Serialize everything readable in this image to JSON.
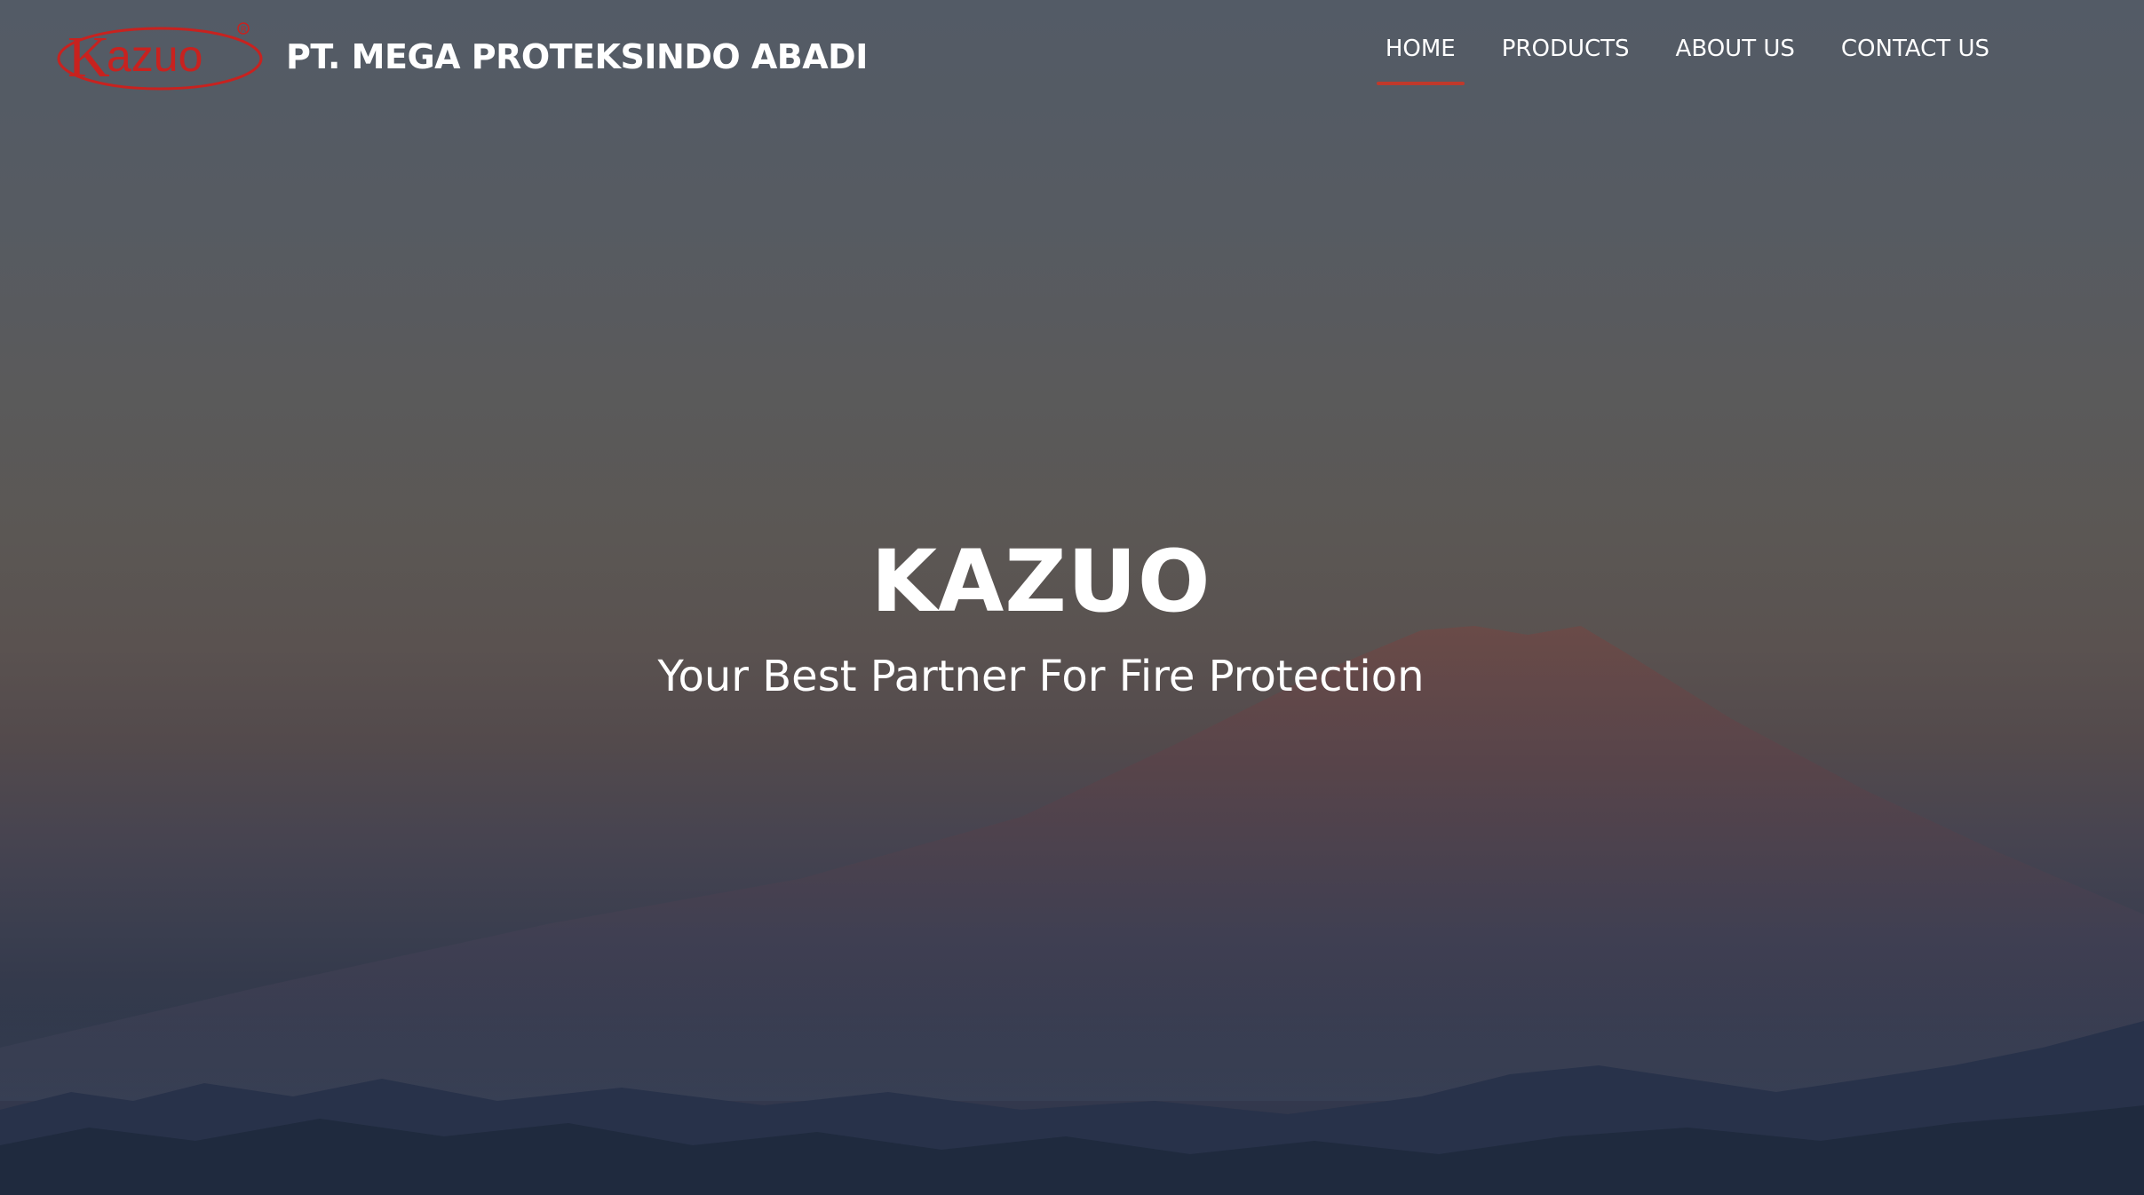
{
  "header": {
    "logo_text": "Kazuo",
    "company_name": "PT. MEGA PROTEKSINDO ABADI"
  },
  "nav": {
    "items": [
      {
        "label": "HOME",
        "active": true
      },
      {
        "label": "PRODUCTS",
        "active": false
      },
      {
        "label": "ABOUT US",
        "active": false
      },
      {
        "label": "CONTACT US",
        "active": false
      }
    ]
  },
  "hero": {
    "title": "KAZUO",
    "subtitle": "Your Best Partner For Fire Protection"
  },
  "colors": {
    "accent": "#c0392b",
    "logo_red": "#c8221f",
    "text": "#ffffff"
  }
}
